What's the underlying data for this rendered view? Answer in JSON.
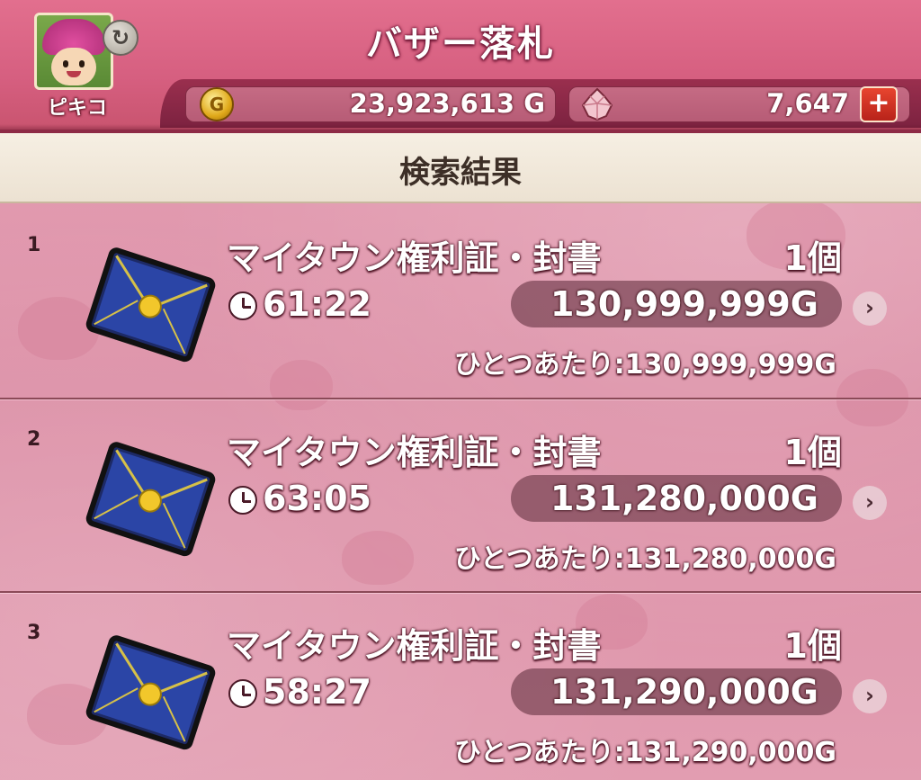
{
  "header": {
    "title": "バザー落札",
    "player_name": "ピキコ",
    "gold": "23,923,613 G",
    "gold_icon": "G",
    "gems": "7,647",
    "add_gems_label": "+"
  },
  "subtitle": "検索結果",
  "results": [
    {
      "rank": "1",
      "name": "マイタウン権利証・封書",
      "quantity": "1個",
      "time_left": "61:22",
      "price": "130,999,999G",
      "unit_price": "ひとつあたり:130,999,999G"
    },
    {
      "rank": "2",
      "name": "マイタウン権利証・封書",
      "quantity": "1個",
      "time_left": "63:05",
      "price": "131,280,000G",
      "unit_price": "ひとつあたり:131,280,000G"
    },
    {
      "rank": "3",
      "name": "マイタウン権利証・封書",
      "quantity": "1個",
      "time_left": "58:27",
      "price": "131,290,000G",
      "unit_price": "ひとつあたり:131,290,000G"
    }
  ],
  "icons": {
    "refresh": "refresh-icon",
    "gold": "gold-coin-icon",
    "gem": "gem-icon",
    "clock": "clock-icon",
    "chevron": "chevron-right-icon",
    "item": "envelope-icon"
  },
  "colors": {
    "header": "#d65f80",
    "header_border": "#8d2a46",
    "background": "#dc8fa6",
    "subtitle_bar": "#f6efe3",
    "plus_button": "#d2321f"
  }
}
